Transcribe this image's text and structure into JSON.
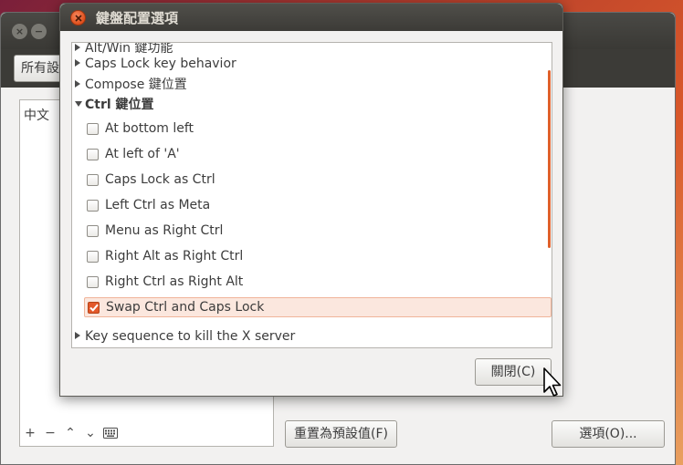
{
  "background": {
    "combo_label": "所有設",
    "list_item": "中文",
    "list_toolbar": {
      "add": "+",
      "remove": "−",
      "up": "⌃",
      "down": "⌄"
    },
    "reset_button": "重置為預設值(F)",
    "options_button": "選項(O)..."
  },
  "dialog": {
    "title": "鍵盤配置選項",
    "groups": [
      {
        "label": "Alt/Win 鍵功能",
        "expanded": false
      },
      {
        "label": "Caps Lock key behavior",
        "expanded": false
      },
      {
        "label": "Compose 鍵位置",
        "expanded": false
      },
      {
        "label": "Ctrl 鍵位置",
        "expanded": true
      },
      {
        "label": "Key sequence to kill the X server",
        "expanded": false
      }
    ],
    "ctrl_options": [
      {
        "label": "At bottom left",
        "checked": false
      },
      {
        "label": "At left of 'A'",
        "checked": false
      },
      {
        "label": "Caps Lock as Ctrl",
        "checked": false
      },
      {
        "label": "Left Ctrl as Meta",
        "checked": false
      },
      {
        "label": "Menu as Right Ctrl",
        "checked": false
      },
      {
        "label": "Right Alt as Right Ctrl",
        "checked": false
      },
      {
        "label": "Right Ctrl as Right Alt",
        "checked": false
      },
      {
        "label": "Swap Ctrl and Caps Lock",
        "checked": true
      }
    ],
    "close_button": "關閉(C)"
  },
  "colors": {
    "accent": "#e3582a",
    "title_bar": "#3c3b37",
    "window_bg": "#f2f1f0"
  }
}
